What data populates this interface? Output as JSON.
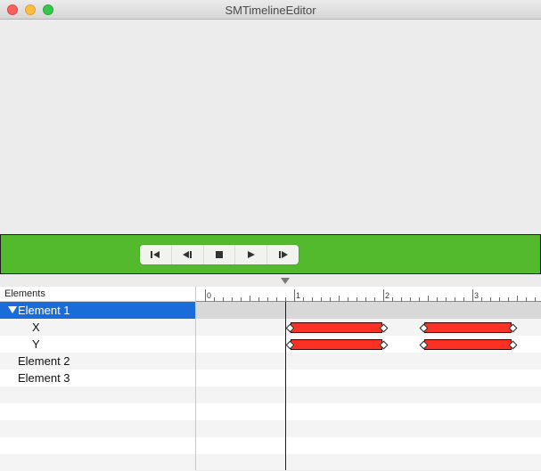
{
  "window": {
    "title": "SMTimelineEditor"
  },
  "colors": {
    "stage": "#53b92d",
    "selection": "#1a6dd8",
    "keyframe_bar": "#fb3124",
    "playhead": "#1e1e1e"
  },
  "transport": {
    "buttons": [
      {
        "name": "rewind-to-start",
        "icon": "skip-to-start-icon"
      },
      {
        "name": "step-back",
        "icon": "step-back-icon"
      },
      {
        "name": "stop",
        "icon": "stop-icon"
      },
      {
        "name": "play",
        "icon": "play-icon"
      },
      {
        "name": "step-forward",
        "icon": "step-forward-icon"
      }
    ]
  },
  "outline": {
    "header": "Elements",
    "rows": [
      {
        "label": "Element 1",
        "level": 0,
        "expanded": true,
        "selected": true
      },
      {
        "label": "X",
        "level": 1
      },
      {
        "label": "Y",
        "level": 1
      },
      {
        "label": "Element 2",
        "level": 0
      },
      {
        "label": "Element 3",
        "level": 0
      }
    ]
  },
  "timeline": {
    "ruler_labels": [
      "0",
      "1",
      "2",
      "3"
    ],
    "playhead_time": 0.9,
    "tracks": [
      {
        "element": "X",
        "segments": [
          [
            0.95,
            2.0
          ],
          [
            2.45,
            3.45
          ]
        ]
      },
      {
        "element": "Y",
        "segments": [
          [
            0.95,
            2.0
          ],
          [
            2.45,
            3.45
          ]
        ]
      }
    ]
  }
}
